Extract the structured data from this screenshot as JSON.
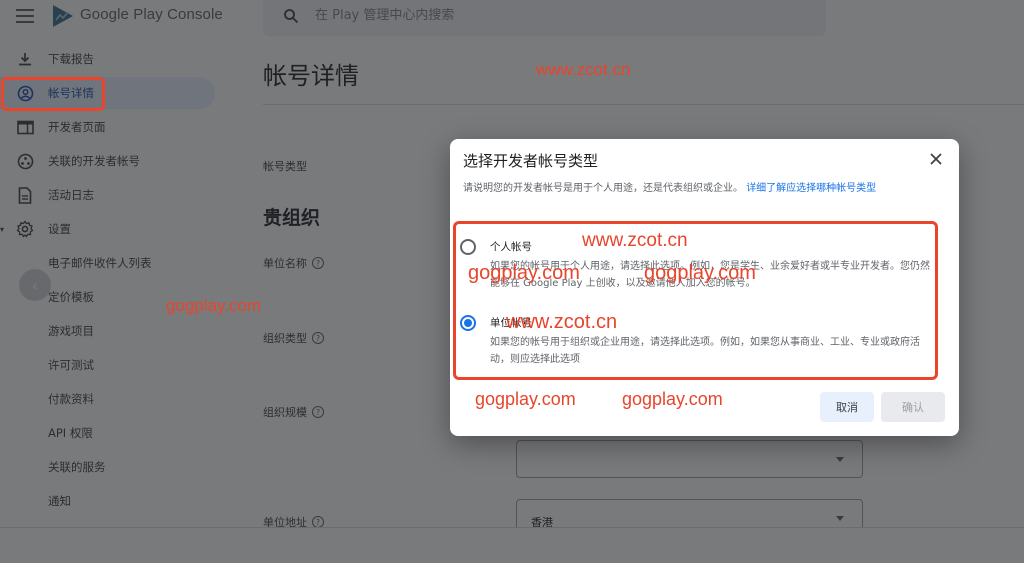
{
  "app": {
    "title": "Google Play Console",
    "search_placeholder": "在 Play 管理中心内搜索"
  },
  "sidebar": {
    "items": [
      {
        "label": "下载报告",
        "icon": "download-icon"
      },
      {
        "label": "帐号详情",
        "icon": "account-circle-icon",
        "active": true
      },
      {
        "label": "开发者页面",
        "icon": "web-page-icon"
      },
      {
        "label": "关联的开发者帐号",
        "icon": "linked-accounts-icon"
      },
      {
        "label": "活动日志",
        "icon": "document-icon"
      },
      {
        "label": "设置",
        "icon": "gear-icon",
        "expanded": true
      },
      {
        "label": "电子邮件收件人列表"
      },
      {
        "label": "定价模板"
      },
      {
        "label": "游戏项目"
      },
      {
        "label": "许可测试"
      },
      {
        "label": "付款资料"
      },
      {
        "label": "API 权限"
      },
      {
        "label": "关联的服务"
      },
      {
        "label": "通知"
      }
    ],
    "collapse_icon": "chevron-left-icon"
  },
  "page": {
    "title": "帐号详情",
    "account_type_label": "帐号类型",
    "section_title": "贵组织",
    "fields": {
      "org_name_label": "单位名称",
      "org_type_label": "组织类型",
      "org_size_label": "组织规模",
      "org_address_label": "单位地址",
      "org_size_value": "",
      "org_address_value": "香港"
    }
  },
  "dialog": {
    "title": "选择开发者帐号类型",
    "description": "请说明您的开发者帐号是用于个人用途，还是代表组织或企业。",
    "learn_more_link": "详细了解应选择哪种帐号类型",
    "options": [
      {
        "label": "个人帐号",
        "description": "如果您的帐号用于个人用途，请选择此选项。例如，您是学生、业余爱好者或半专业开发者。您仍然能够在 Google Play 上创收，以及邀请他人加入您的帐号。",
        "selected": false
      },
      {
        "label": "单位帐号",
        "description": "如果您的帐号用于组织或企业用途，请选择此选项。例如，如果您从事商业、工业、专业或政府活动，则应选择此选项",
        "selected": true
      }
    ],
    "cancel_label": "取消",
    "confirm_label": "确认",
    "confirm_enabled": false
  },
  "watermarks": {
    "zcot": "www.zcot.cn",
    "gogplay": "gogplay.com"
  },
  "colors": {
    "accent": "#1a73e8",
    "highlight_red": "#e8452c",
    "active_nav_bg": "#e8f0fe"
  }
}
